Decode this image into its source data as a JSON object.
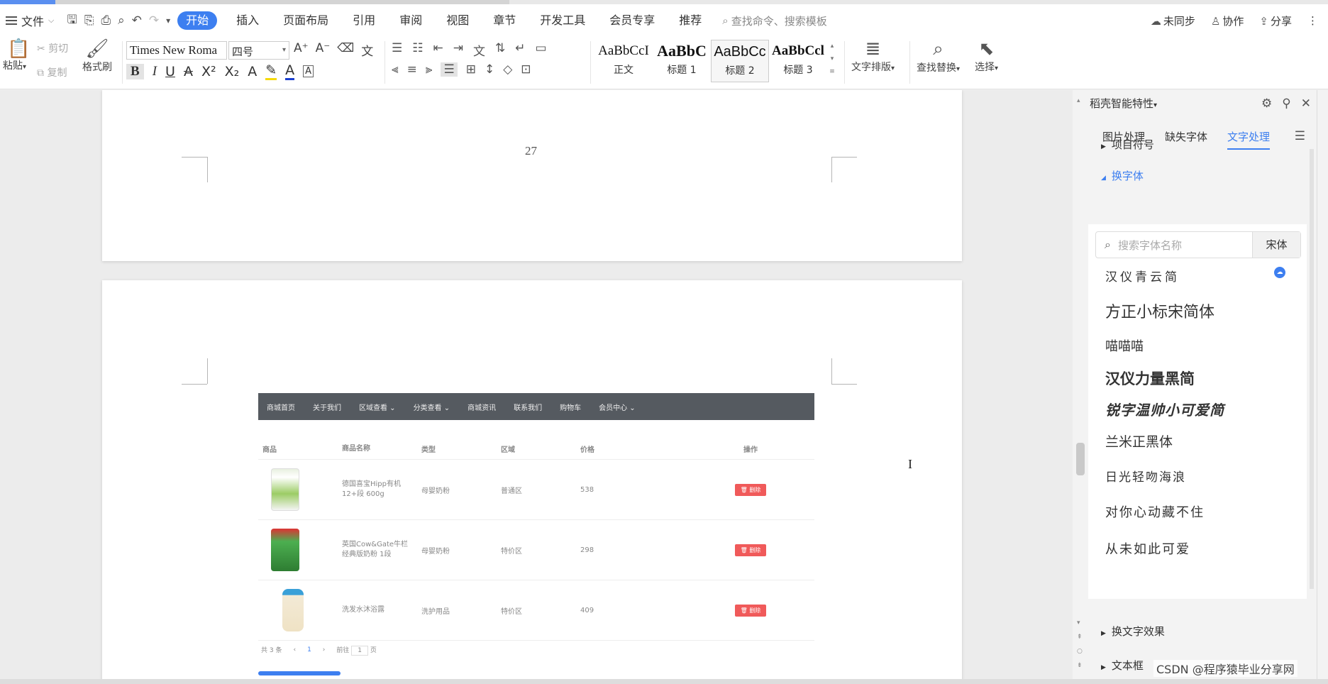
{
  "menu": {
    "file_label": "文件",
    "tabs": [
      "开始",
      "插入",
      "页面布局",
      "引用",
      "审阅",
      "视图",
      "章节",
      "开发工具",
      "会员专享",
      "推荐"
    ],
    "search_placeholder": "查找命令、搜索模板",
    "sync_label": "未同步",
    "collab_label": "协作",
    "share_label": "分享"
  },
  "ribbon": {
    "paste_label": "粘贴",
    "cut_label": "剪切",
    "copy_label": "复制",
    "format_painter_label": "格式刷",
    "font_name": "Times New Roma",
    "font_size": "四号",
    "styles": [
      {
        "preview": "AaBbCcI",
        "label": "正文"
      },
      {
        "preview": "AaBbC",
        "label": "标题 1"
      },
      {
        "preview": "AaBbCc",
        "label": "标题 2"
      },
      {
        "preview": "AaBbCcl",
        "label": "标题 3"
      }
    ],
    "text_layout_label": "文字排版",
    "find_replace_label": "查找替换",
    "select_label": "选择"
  },
  "document": {
    "page_number": "27",
    "screenshot": {
      "nav": [
        "商城首页",
        "关于我们",
        "区域查看 ⌄",
        "分类查看 ⌄",
        "商城资讯",
        "联系我们",
        "购物车",
        "会员中心 ⌄"
      ],
      "headers": [
        "商品",
        "商品名称",
        "类型",
        "区域",
        "价格",
        "操作"
      ],
      "rows": [
        {
          "name": "德国喜宝Hipp有机 12+段 600g",
          "type": "母婴奶粉",
          "region": "普通区",
          "price": "538",
          "action": "删除"
        },
        {
          "name": "英国Cow&Gate牛栏 经典版奶粉 1段",
          "type": "母婴奶粉",
          "region": "特价区",
          "price": "298",
          "action": "删除"
        },
        {
          "name": "洗发水沐浴露",
          "type": "洗护用品",
          "region": "特价区",
          "price": "409",
          "action": "删除"
        }
      ],
      "pager": {
        "total": "共 3 条",
        "page": "1",
        "goto": "前往",
        "goto_page": "1",
        "page_unit": "页"
      }
    }
  },
  "panel": {
    "title": "稻壳智能特性",
    "tabs": [
      "图片处理",
      "缺失字体",
      "文字处理"
    ],
    "active_tab": "文字处理",
    "sections": {
      "bullets": "项目符号",
      "change_font": "换字体",
      "change_effect": "换文字效果",
      "textbox": "文本框"
    },
    "font_search_placeholder": "搜索字体名称",
    "font_search_button": "宋体",
    "fonts": [
      "汉仪青云简",
      "方正小标宋简体",
      "喵喵喵",
      "汉仪力量黑简",
      "锐字温帅小可爱简",
      "兰米正黑体",
      "日光轻吻海浪",
      "对你心动藏不住",
      "从未如此可爱"
    ]
  },
  "watermark": "CSDN @程序猿毕业分享网",
  "colors": {
    "accent": "#3d7ff0",
    "delete_button": "#f05a5a",
    "nav_bar": "#555a60"
  }
}
